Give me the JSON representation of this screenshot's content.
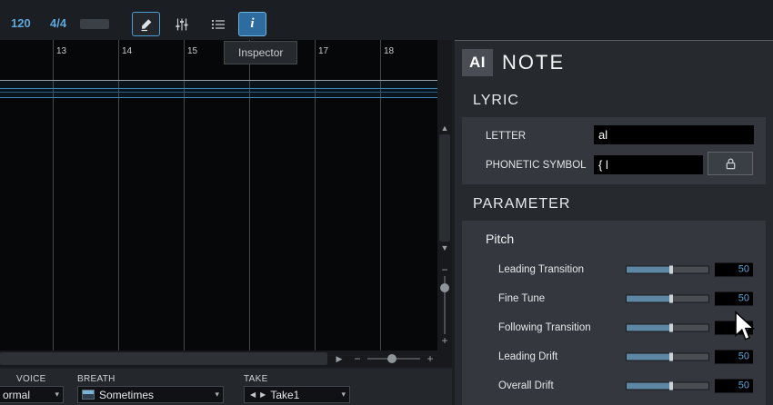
{
  "colors": {
    "accent_blue": "#5da9dc",
    "slider_fill": "#5d87a2",
    "panel_bg": "#34383e"
  },
  "icons": {
    "up_arrow": "▲",
    "down_arrow": "▼",
    "minus": "−",
    "plus": "+",
    "auto_scroll": "▶",
    "chevron_down": "▾",
    "take_prev": "◀",
    "take_next": "▶"
  },
  "toolbar": {
    "tempo": "120",
    "time_signature": "4/4",
    "info_label": "i",
    "tooltip": "Inspector"
  },
  "ruler": {
    "measures": [
      "13",
      "14",
      "15",
      "17",
      "18"
    ]
  },
  "bottom_bar": {
    "voice": {
      "label": "VOICE",
      "value": "ormal"
    },
    "breath": {
      "label": "BREATH",
      "value": "Sometimes"
    },
    "take": {
      "label": "TAKE",
      "value": "Take1"
    }
  },
  "inspector": {
    "ai_badge": "AI",
    "title": "NOTE",
    "lyric": {
      "header": "LYRIC",
      "letter_label": "LETTER",
      "letter_value": "al",
      "phonetic_label": "PHONETIC SYMBOL",
      "phonetic_value": "{ l"
    },
    "parameter": {
      "header": "PARAMETER",
      "group": "Pitch",
      "rows": [
        {
          "label": "Leading Transition",
          "value": "50"
        },
        {
          "label": "Fine Tune",
          "value": "50"
        },
        {
          "label": "Following Transition",
          "value": "50"
        },
        {
          "label": "Leading Drift",
          "value": "50"
        },
        {
          "label": "Overall Drift",
          "value": "50"
        }
      ]
    }
  }
}
